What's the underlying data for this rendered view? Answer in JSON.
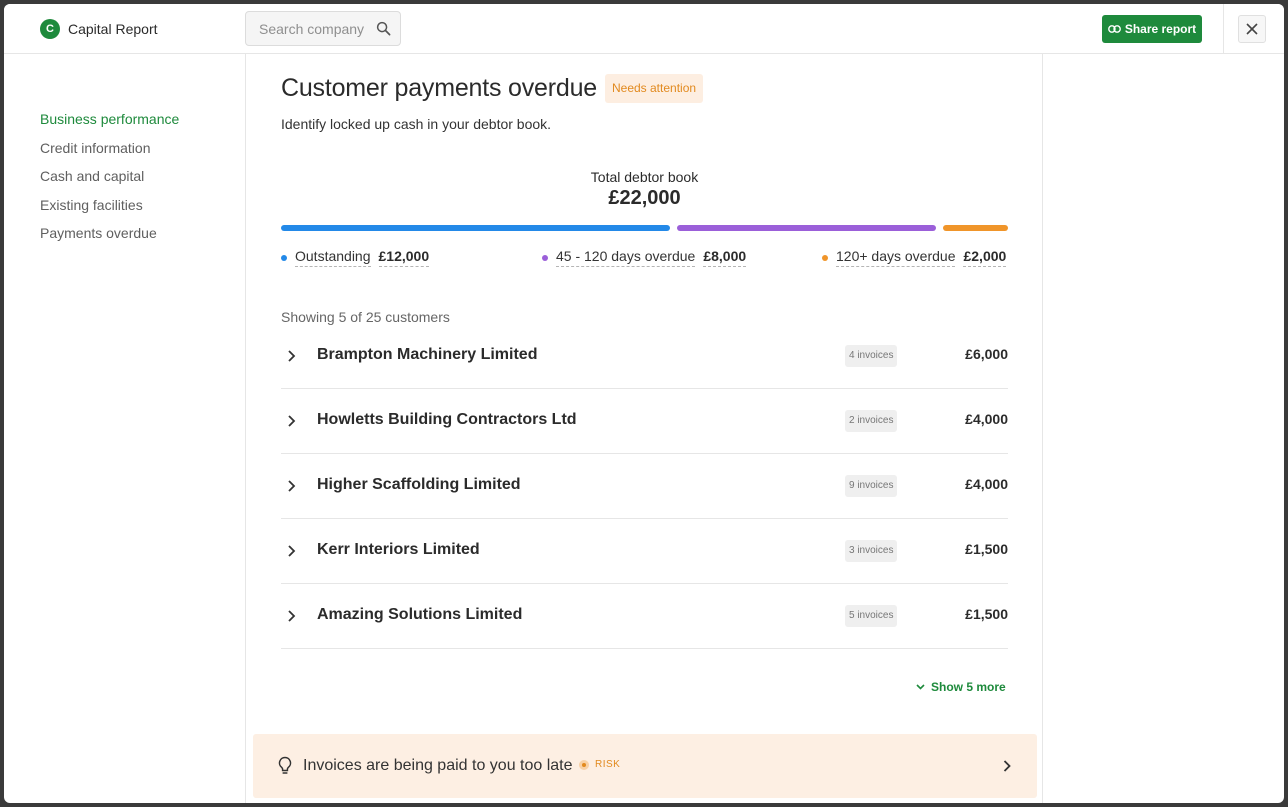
{
  "app": {
    "name": "Capital Report",
    "logo_letter": "C"
  },
  "search": {
    "placeholder": "Search company"
  },
  "header": {
    "share_label": "Share report"
  },
  "sidebar": {
    "items": [
      {
        "label": "Business performance",
        "active": true
      },
      {
        "label": "Credit information",
        "active": false
      },
      {
        "label": "Cash and capital",
        "active": false
      },
      {
        "label": "Existing facilities",
        "active": false
      },
      {
        "label": "Payments overdue",
        "active": false
      }
    ]
  },
  "main": {
    "title": "Customer payments overdue",
    "status_badge": "Needs attention",
    "subtitle": "Identify locked up cash in your debtor book.",
    "total_label": "Total debtor book",
    "total_value": "£22,000",
    "breakdown": [
      {
        "label": "Outstanding",
        "value": "£12,000",
        "amount": 12000,
        "color": "#2389e8"
      },
      {
        "label": "45 - 120 days overdue",
        "value": "£8,000",
        "amount": 8000,
        "color": "#9b5fd9"
      },
      {
        "label": "120+ days overdue",
        "value": "£2,000",
        "amount": 2000,
        "color": "#f0952a"
      }
    ],
    "showing_text": "Showing 5 of 25 customers",
    "customers": [
      {
        "name": "Brampton Machinery Limited",
        "invoices": "4 invoices",
        "amount": "£6,000"
      },
      {
        "name": "Howletts Building Contractors Ltd",
        "invoices": "2 invoices",
        "amount": "£4,000"
      },
      {
        "name": "Higher Scaffolding Limited",
        "invoices": "9 invoices",
        "amount": "£4,000"
      },
      {
        "name": "Kerr Interiors Limited",
        "invoices": "3 invoices",
        "amount": "£1,500"
      },
      {
        "name": "Amazing Solutions Limited",
        "invoices": "5 invoices",
        "amount": "£1,500"
      }
    ],
    "show_more_label": "Show 5 more",
    "insight": {
      "text": "Invoices are being paid to you too late",
      "risk_label": "RISK"
    }
  },
  "colors": {
    "brand": "#1e8a3c",
    "warning": "#e28a1f",
    "insight_bg": "#fdefe3"
  }
}
